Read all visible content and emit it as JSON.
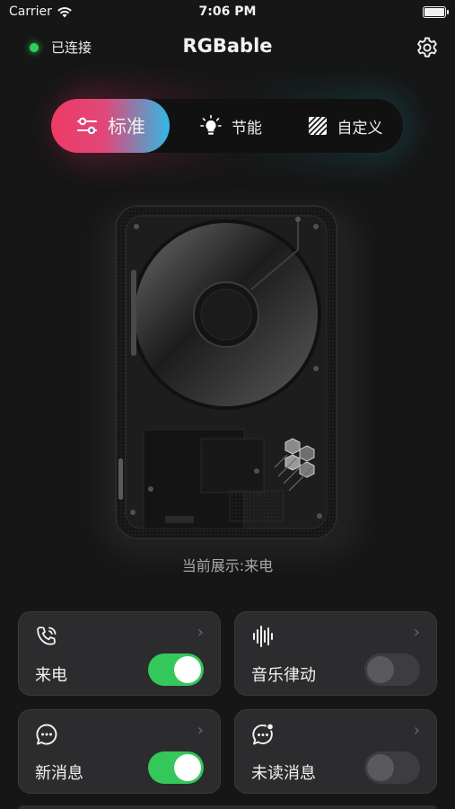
{
  "status_bar": {
    "carrier": "Carrier",
    "time": "7:06 PM",
    "battery_level": 1.0
  },
  "header": {
    "connection_status": "已连接",
    "title": "RGBable",
    "settings_icon": "gear-icon",
    "status_color": "#2fd15a"
  },
  "mode_tabs": [
    {
      "label": "标准",
      "icon": "sliders-icon",
      "active": true
    },
    {
      "label": "节能",
      "icon": "bulb-icon",
      "active": false
    },
    {
      "label": "自定义",
      "icon": "custom-pattern-icon",
      "active": false
    }
  ],
  "preview": {
    "caption": "当前展示:来电"
  },
  "features": [
    {
      "label": "来电",
      "icon": "phone-call-icon",
      "enabled": true
    },
    {
      "label": "音乐律动",
      "icon": "sound-wave-icon",
      "enabled": false
    },
    {
      "label": "新消息",
      "icon": "message-icon",
      "enabled": true
    },
    {
      "label": "未读消息",
      "icon": "unread-message-icon",
      "enabled": false
    }
  ],
  "colors": {
    "accent_pink": "#ee3a64",
    "accent_cyan": "#30b8e4",
    "toggle_on": "#34c759"
  }
}
